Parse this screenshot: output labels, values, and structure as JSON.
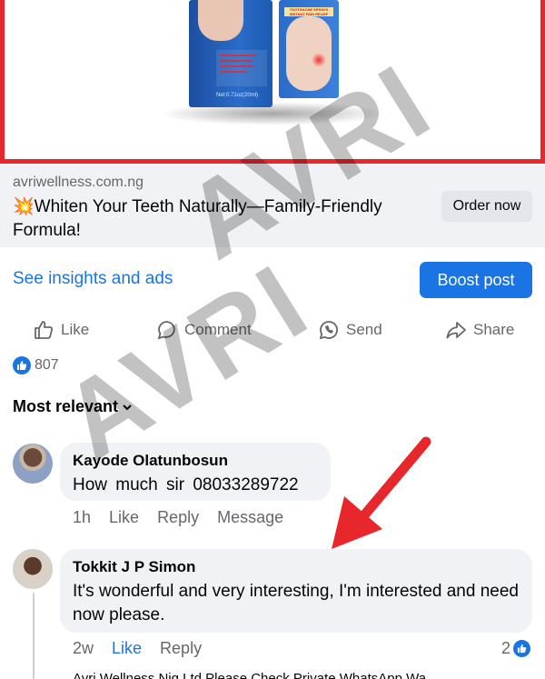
{
  "ad": {
    "product_label": "TOOTHACHE SPRAYS INSTANT PAIN RELIEF",
    "net_label": "Net:0.71oz(20ml)"
  },
  "link": {
    "domain": "avriwellness.com.ng",
    "emoji": "💥",
    "headline": "Whiten Your Teeth Naturally—Family-Friendly Formula!",
    "cta": "Order now"
  },
  "insights": {
    "link_text": "See insights and ads",
    "boost_label": "Boost post"
  },
  "actions": {
    "like": "Like",
    "comment": "Comment",
    "send": "Send",
    "share": "Share"
  },
  "reactions": {
    "count": "807"
  },
  "filter": {
    "label": "Most relevant"
  },
  "comments": [
    {
      "author": "Kayode Olatunbosun",
      "text": "How  much  sir 08033289722",
      "time": "1h",
      "like": "Like",
      "reply": "Reply",
      "message": "Message"
    },
    {
      "author": "Tokkit J P Simon",
      "text": "It's wonderful and very interesting, I'm interested and need now please.",
      "time": "2w",
      "like": "Like",
      "reply": "Reply",
      "reaction_count": "2"
    }
  ],
  "reply_preview": "Avri Wellness Nig Ltd Please Check Private WhatsApp Wa",
  "watermark": "AVRI",
  "colors": {
    "accent": "#1b74e4",
    "arrow": "#e8272d",
    "ad_border": "#e8272d"
  }
}
